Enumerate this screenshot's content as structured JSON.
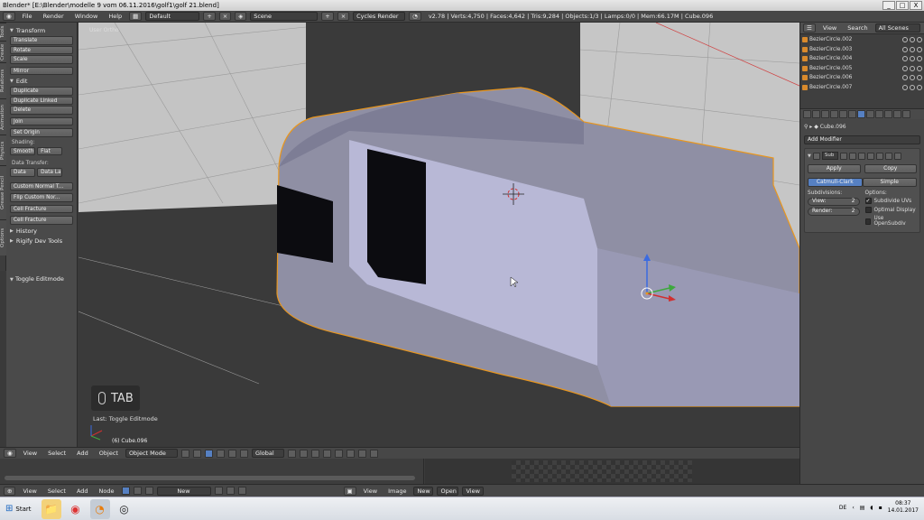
{
  "window": {
    "title": "Blender* [E:\\Blender\\modelle 9 vom 06.11.2016\\golf1\\golf 21.blend]",
    "buttons": [
      "_",
      "□",
      "X"
    ]
  },
  "info_header": {
    "menus": [
      "File",
      "Render",
      "Window",
      "Help"
    ],
    "screen_layout": "Default",
    "scene": "Scene",
    "render_engine": "Cycles Render",
    "stats": "v2.78 | Verts:4,750 | Faces:4,642 | Tris:9,284 | Objects:1/3 | Lamps:0/0 | Mem:66.17M | Cube.096"
  },
  "tool_tabs": [
    "Tools",
    "Create",
    "Relations",
    "Animation",
    "Physics",
    "Grease Pencil",
    "Options"
  ],
  "toolshelf": {
    "transform_title": "Transform",
    "transform_buttons": [
      "Translate",
      "Rotate",
      "Scale"
    ],
    "mirror": "Mirror",
    "edit_title": "Edit",
    "edit_buttons": [
      "Duplicate",
      "Duplicate Linked",
      "Delete"
    ],
    "join": "Join",
    "set_origin": "Set Origin",
    "shading_label": "Shading:",
    "smooth": "Smooth",
    "flat": "Flat",
    "data_transfer_label": "Data Transfer:",
    "data": "Data",
    "data_la": "Data La",
    "custom_normal": "Custom Normal T...",
    "flip_custom": "Flip Custom Nor...",
    "cell_fracture_1": "Cell Fracture",
    "cell_fracture_2": "Cell Fracture",
    "history_title": "History",
    "rigify_title": "Rigify Dev Tools",
    "toggle_editmode": "Toggle Editmode"
  },
  "viewport": {
    "persp_label": "User Ortho",
    "key_display": "TAB",
    "last_op": "Last: Toggle Editmode",
    "object_label": "(6) Cube.096"
  },
  "outliner": {
    "view": "View",
    "search": "Search",
    "all_scenes": "All Scenes",
    "items": [
      "BezierCircle.002",
      "BezierCircle.003",
      "BezierCircle.004",
      "BezierCircle.005",
      "BezierCircle.006",
      "BezierCircle.007"
    ]
  },
  "properties": {
    "breadcrumb": "Cube.096",
    "add_modifier": "Add Modifier",
    "modifier_name": "Sub",
    "apply": "Apply",
    "copy": "Copy",
    "catmull": "Catmull-Clark",
    "simple": "Simple",
    "subdivisions_label": "Subdivisions:",
    "options_label": "Options:",
    "view_label": "View:",
    "view_value": "2",
    "render_label": "Render:",
    "render_value": "2",
    "subdivide_uvs": "Subdivide UVs",
    "optimal_display": "Optimal Display",
    "use_opensubdiv": "Use OpenSubdiv"
  },
  "viewport_header": {
    "menus": [
      "View",
      "Select",
      "Add",
      "Object"
    ],
    "mode": "Object Mode",
    "orientation": "Global"
  },
  "bottom_header": {
    "left_menus": [
      "View",
      "Select",
      "Add",
      "Node"
    ],
    "new_left": "New",
    "right_menus": [
      "View",
      "Image"
    ],
    "new_right": "New",
    "open": "Open",
    "view2": "View"
  },
  "taskbar": {
    "start": "Start",
    "lang": "DE",
    "time": "08:37",
    "date": "14.01.2017"
  },
  "colors": {
    "ui_bg": "#474747",
    "viewport_bg": "#393939",
    "selection_outline": "#e8961e",
    "accent_blue": "#5680c2"
  }
}
